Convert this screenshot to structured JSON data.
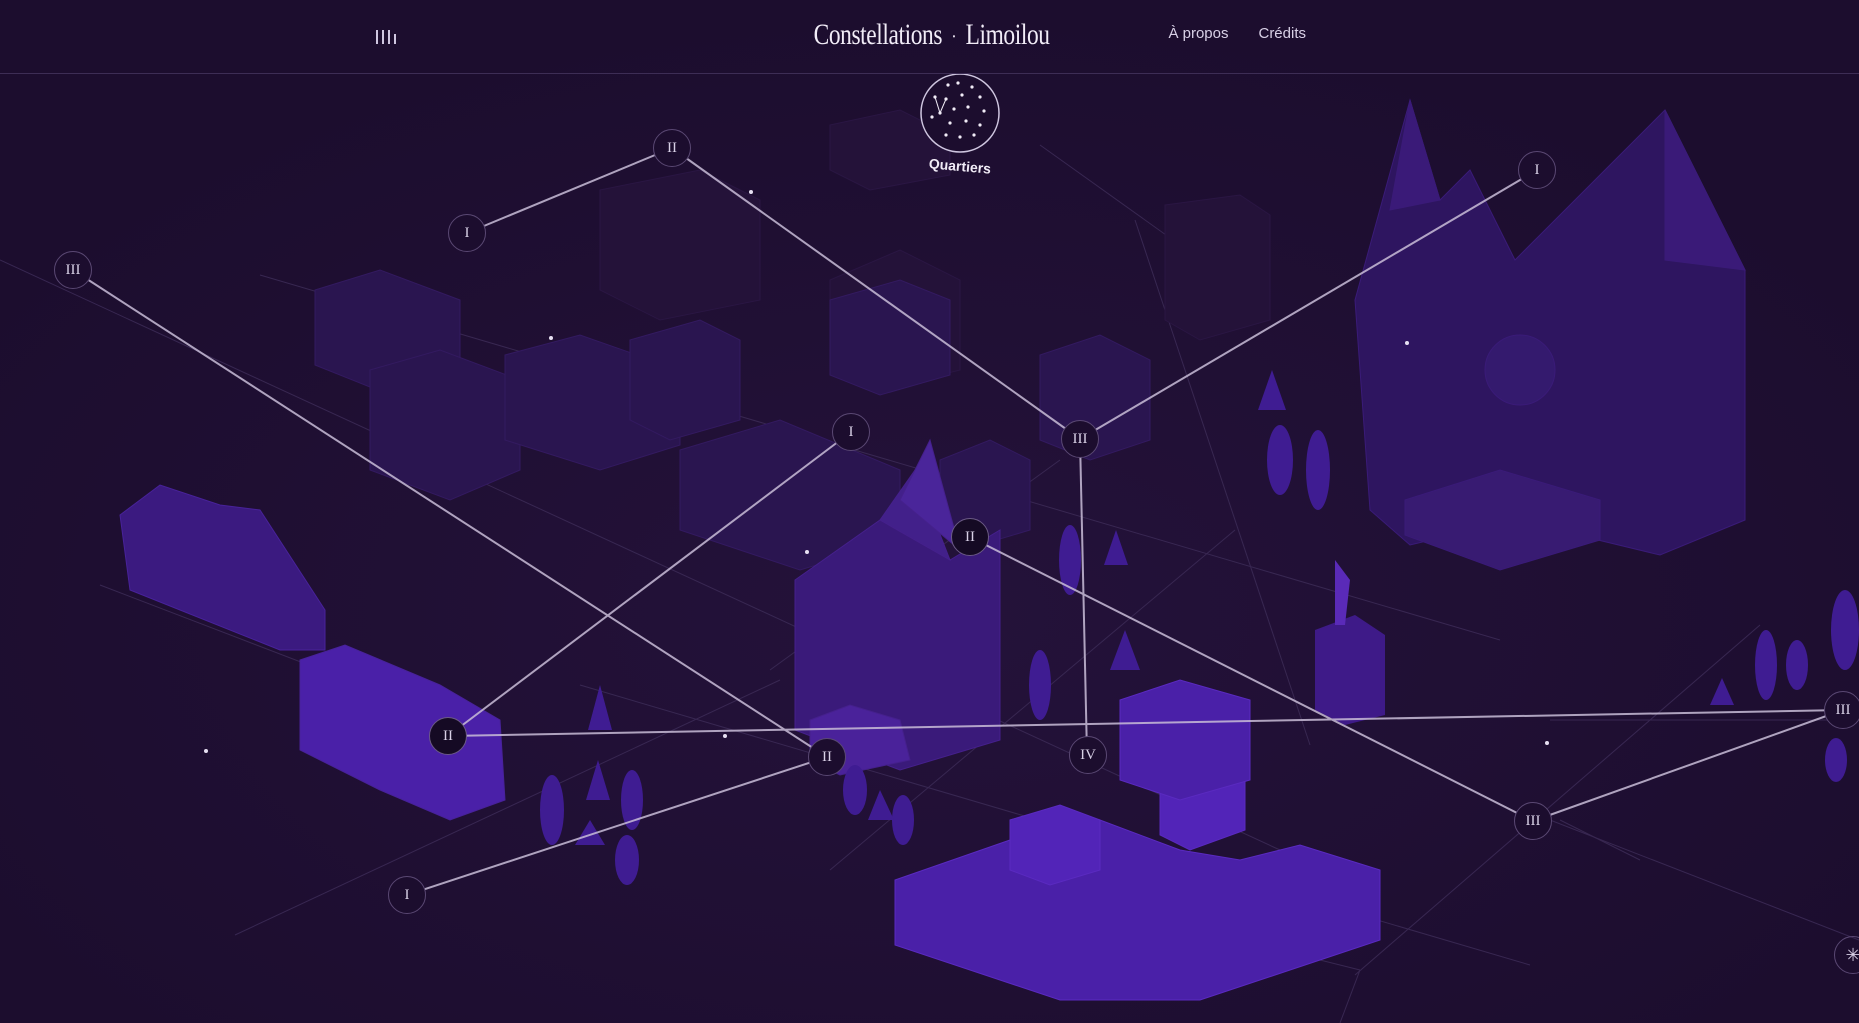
{
  "header": {
    "brand_name": "Constellations",
    "brand_separator": "·",
    "brand_place": "Limoilou",
    "nav": [
      {
        "label": "À propos"
      },
      {
        "label": "Crédits"
      }
    ]
  },
  "quartiers": {
    "label": "Quartiers"
  },
  "nodes": [
    {
      "label": "II"
    },
    {
      "label": "I"
    },
    {
      "label": "III"
    },
    {
      "label": "I"
    },
    {
      "label": "I"
    },
    {
      "label": "III"
    },
    {
      "label": "II"
    },
    {
      "label": "II"
    },
    {
      "label": "II"
    },
    {
      "label": "IV"
    },
    {
      "label": "III"
    },
    {
      "label": "III"
    },
    {
      "label": "I"
    }
  ],
  "corner_button": {
    "icon": "asterisk-icon",
    "glyph": "✳"
  },
  "colors": {
    "background": "#1c0d2e",
    "building": "#3d1a8a",
    "constellation_line": "#c9bdd8",
    "node_border": "#5a4873",
    "text": "#f1ecf7"
  }
}
